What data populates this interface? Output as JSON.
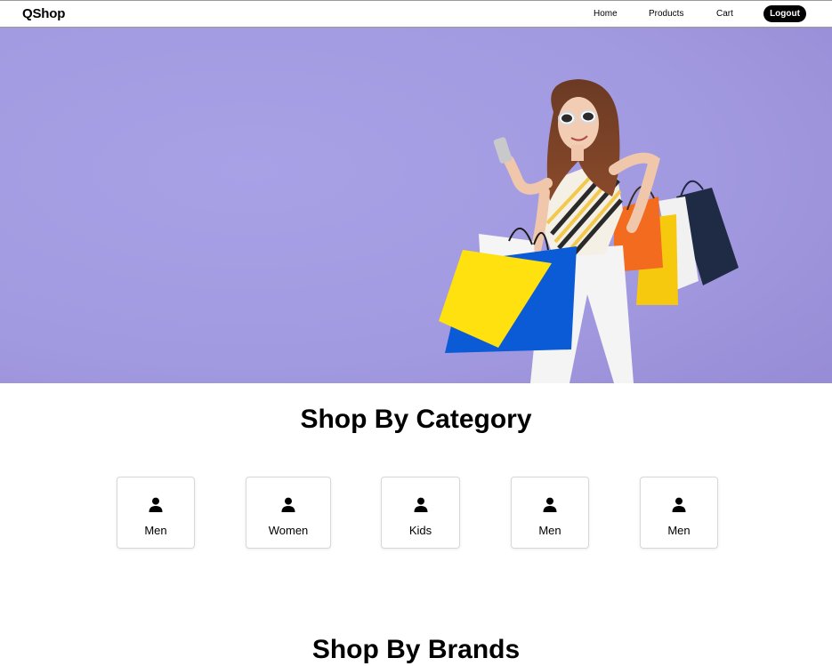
{
  "navbar": {
    "brand": "QShop",
    "links": [
      {
        "label": "Home"
      },
      {
        "label": "Products"
      },
      {
        "label": "Cart"
      }
    ],
    "logout_label": "Logout"
  },
  "hero": {
    "background_color": "#a59de2",
    "image_icon": "woman-with-shopping-bags"
  },
  "category_section": {
    "title": "Shop By Category",
    "icon": "user-icon",
    "items": [
      {
        "label": "Men"
      },
      {
        "label": "Women"
      },
      {
        "label": "Kids"
      },
      {
        "label": "Men"
      },
      {
        "label": "Men"
      }
    ]
  },
  "brands_section": {
    "title": "Shop By Brands"
  }
}
